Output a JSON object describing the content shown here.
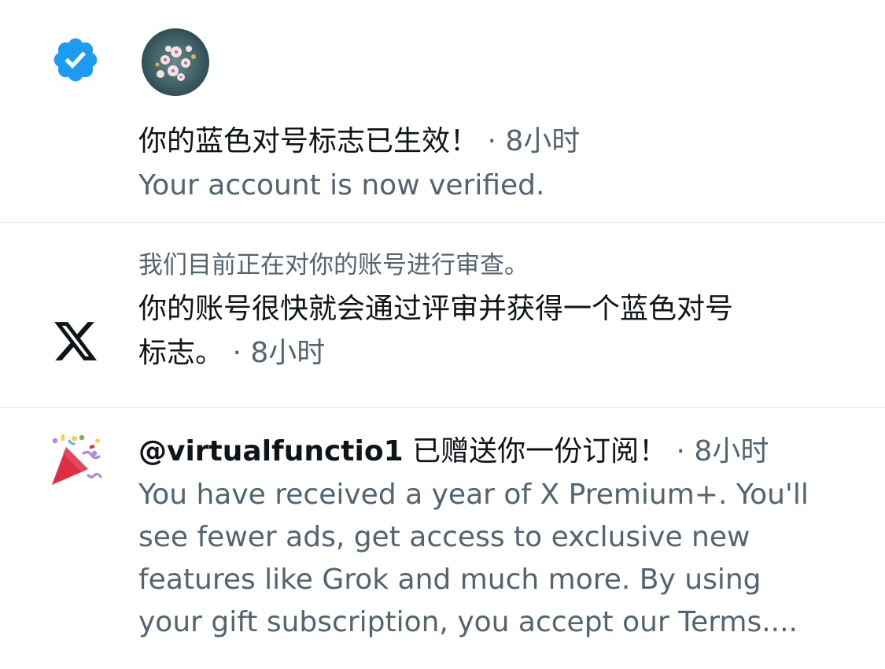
{
  "notifications": [
    {
      "icon": "verified-badge-icon",
      "title": "你的蓝色对号标志已生效！",
      "time": " · 8小时",
      "body": "Your account is now verified."
    },
    {
      "icon": "x-logo-icon",
      "context": "我们目前正在对你的账号进行审查。",
      "title_line1": "你的账号很快就会通过评审并获得一个蓝色对号",
      "title_line2": "标志。",
      "time": " · 8小时"
    },
    {
      "icon": "party-popper-icon",
      "handle": "@virtualfunctio1",
      "title": " 已赠送你一份订阅！",
      "time": " · 8小时",
      "body_lines": [
        "You have received a year of X Premium+. You'll",
        "see fewer ads, get access to exclusive new",
        "features like Grok and much more. By using",
        "your gift subscription, you accept our Terms...."
      ]
    }
  ],
  "colors": {
    "verified_blue": "#1d9bf0",
    "secondary_text": "#536471",
    "primary_text": "#0f1419",
    "divider": "#e1e4e7"
  }
}
